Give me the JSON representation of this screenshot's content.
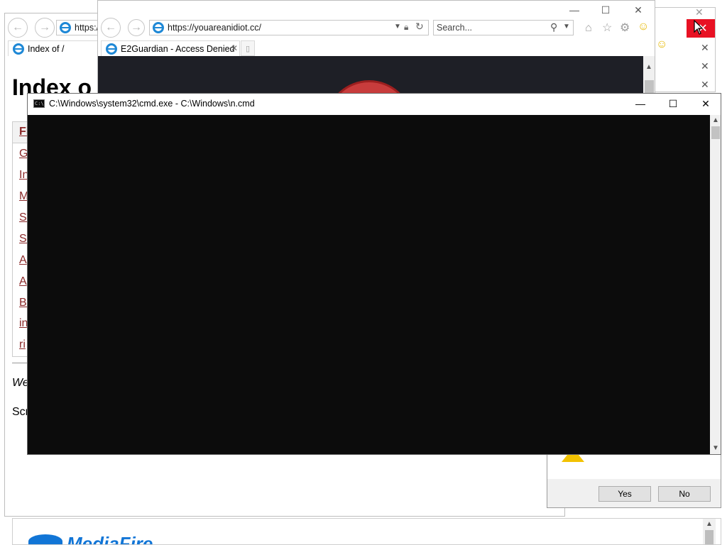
{
  "back_window": {
    "address": "https://",
    "tab_label": "Index of /",
    "heading": "Index o",
    "links": [
      "Fi",
      "G",
      "In",
      "M",
      "SV",
      "Sc",
      "A",
      "A",
      "Ba",
      "in",
      "ri"
    ],
    "footer_italic": "We",
    "footer_text": "Scr"
  },
  "front_ie": {
    "address": "https://youareanidiot.cc/",
    "search_placeholder": "Search...",
    "tab_label": "E2Guardian - Access Denied"
  },
  "cmd": {
    "title": "C:\\Windows\\system32\\cmd.exe - C:\\Windows\\n.cmd"
  },
  "dialog": {
    "yes_label": "Yes",
    "no_label": "No"
  },
  "mediafire": {
    "logo_text": "MediaFire"
  },
  "colors": {
    "cmd_bg": "#0c0c0c",
    "link": "#8b2a2a",
    "close_red": "#e81123",
    "ie_blue": "#1e88d6"
  }
}
